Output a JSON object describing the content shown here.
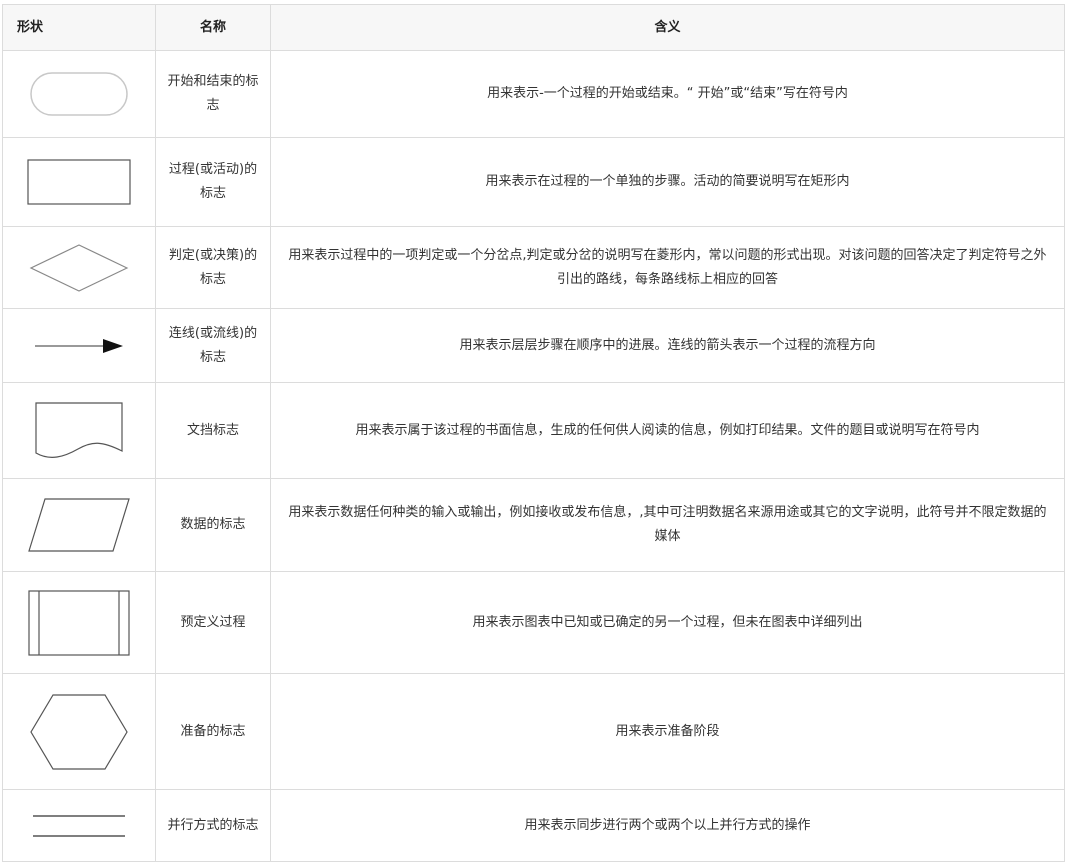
{
  "header": {
    "shape": "形状",
    "name": "名称",
    "meaning": "含义"
  },
  "rows": [
    {
      "shape_icon": "terminator-icon",
      "name": "开始和结束的标志",
      "meaning": "用来表示-一个过程的开始或结束。“ 开始”或“结束”写在符号内"
    },
    {
      "shape_icon": "process-rectangle-icon",
      "name": "过程(或活动)的标志",
      "meaning": "用来表示在过程的一个单独的步骤。活动的简要说明写在矩形内"
    },
    {
      "shape_icon": "decision-diamond-icon",
      "name": "判定(或决策)的标志",
      "meaning": "用来表示过程中的一项判定或一个分岔点,判定或分岔的说明写在菱形内，常以问题的形式出现。对该问题的回答决定了判定符号之外引出的路线，每条路线标上相应的回答"
    },
    {
      "shape_icon": "arrow-icon",
      "name": "连线(或流线)的标志",
      "meaning": "用来表示层层步骤在顺序中的进展。连线的箭头表示一个过程的流程方向"
    },
    {
      "shape_icon": "document-icon",
      "name": "文挡标志",
      "meaning": "用来表示属于该过程的书面信息，生成的任何供人阅读的信息，例如打印结果。文件的题目或说明写在符号内"
    },
    {
      "shape_icon": "data-parallelogram-icon",
      "name": "数据的标志",
      "meaning": "用来表示数据任何种类的输入或输出，例如接收或发布信息，,其中可注明数据名来源用途或其它的文字说明，此符号并不限定数据的媒体"
    },
    {
      "shape_icon": "predefined-process-icon",
      "name": "预定义过程",
      "meaning": "用来表示图表中已知或已确定的另一个过程，但未在图表中详细列出"
    },
    {
      "shape_icon": "preparation-hexagon-icon",
      "name": "准备的标志",
      "meaning": "用来表示准备阶段"
    },
    {
      "shape_icon": "parallel-lines-icon",
      "name": "并行方式的标志",
      "meaning": "用来表示同步进行两个或两个以上并行方式的操作"
    }
  ]
}
